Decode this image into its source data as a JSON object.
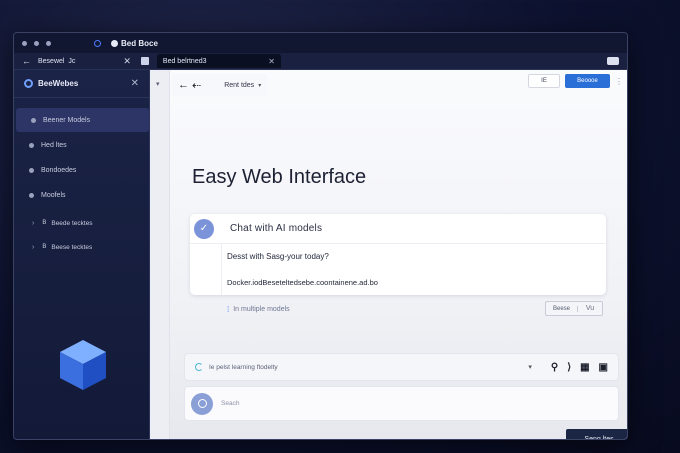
{
  "window": {
    "title": "Bed Boce"
  },
  "tabbar": {
    "back_tab": "Besewel",
    "back_tab_suffix": "Jc",
    "active_tab": "Bed belrtned3"
  },
  "sidebar": {
    "title": "BeeWebes",
    "items": [
      {
        "label": "Beener Models",
        "active": true
      },
      {
        "label": "Hed ltes",
        "active": false
      },
      {
        "label": "Bondoedes",
        "active": false
      },
      {
        "label": "Moofels",
        "active": false
      }
    ],
    "subitems": [
      {
        "label": "Beede tecktes"
      },
      {
        "label": "Beese tecktes"
      }
    ]
  },
  "main": {
    "strip_icon": "▾",
    "nav_label": "Rent tdes",
    "top_right": {
      "mini_button": "IE",
      "primary_button": "Beoooe"
    },
    "heading": "Easy Web Interface",
    "card": {
      "title": "Chat with AI models",
      "line1": "Desst with Sasg-your today?",
      "line2": "Docker.iodBeseteltedsebe.coontainene.ad.bo"
    },
    "multi": "In multiple models",
    "toggle": {
      "a": "Beese",
      "b": "Vu"
    },
    "toolbar": {
      "text": "Ie pelst learning ftodelty",
      "dropdown": "▾"
    },
    "input": {
      "placeholder": "Seach"
    },
    "send_button": "Seng ltes"
  },
  "colors": {
    "accent": "#2a6ed8",
    "sidebar_bg": "#1b2346",
    "check_bg": "#7b93d8",
    "send_bg": "#1b2544"
  }
}
